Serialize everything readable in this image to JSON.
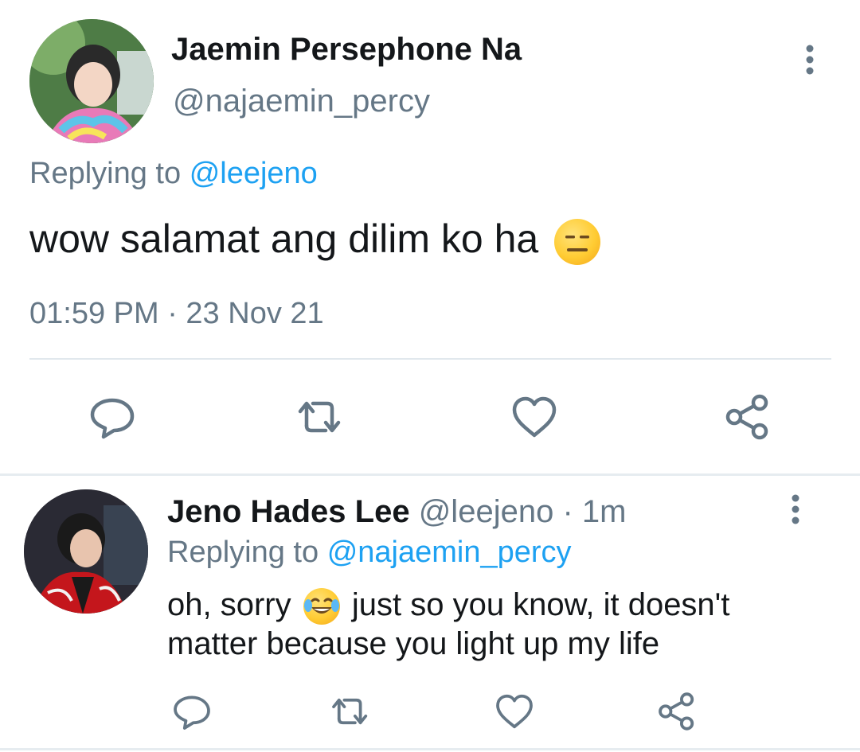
{
  "main_tweet": {
    "author_name": "Jaemin Persephone Na",
    "handle": "@najaemin_percy",
    "replying_prefix": "Replying to",
    "replying_to": "@leejeno",
    "text": "wow salamat ang dilim ko ha",
    "text_emoji": "expressionless-face-emoji",
    "timestamp": "01:59 PM · 23 Nov 21",
    "actions": [
      "reply-icon",
      "retweet-icon",
      "like-icon",
      "share-icon"
    ]
  },
  "reply_tweet": {
    "author_name": "Jeno Hades Lee",
    "handle": "@leejeno",
    "time_separator": "·",
    "time_ago": "1m",
    "replying_prefix": "Replying to",
    "replying_to": "@najaemin_percy",
    "text_before_emoji": "oh, sorry",
    "text_emoji": "face-with-tears-of-joy-emoji",
    "text_after_emoji": "just so you know, it doesn't matter because you light up my life",
    "actions": [
      "reply-icon",
      "retweet-icon",
      "like-icon",
      "share-icon"
    ]
  },
  "colors": {
    "link": "#1da1f2",
    "muted": "#657786",
    "text": "#14171a",
    "divider": "#e1e8ed"
  }
}
